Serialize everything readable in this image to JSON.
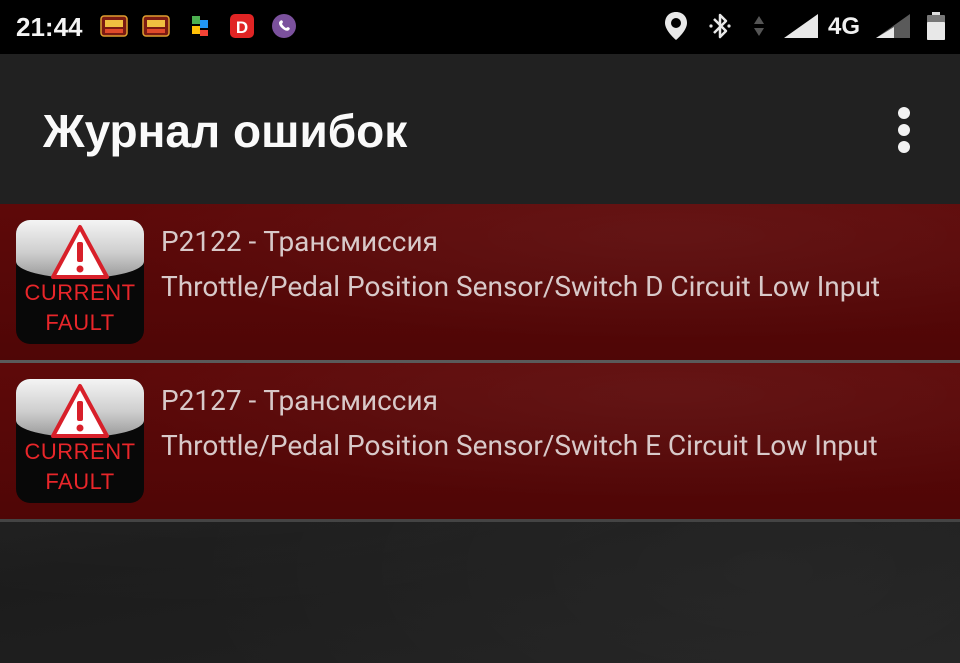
{
  "status_bar": {
    "time": "21:44",
    "network": "4G",
    "notification_icons": [
      "obd-app-icon",
      "obd-app-icon",
      "puzzle-icon",
      "d-app-icon",
      "viber-icon"
    ],
    "system_icons": [
      "location-icon",
      "bluetooth-icon",
      "data-arrows-icon",
      "signal-icon",
      "signal-icon",
      "battery-icon"
    ]
  },
  "app_bar": {
    "title": "Журнал ошибок",
    "overflow_icon": "more-vert-icon"
  },
  "faults": [
    {
      "code": "P2122 - Трансмиссия",
      "description": "Throttle/Pedal Position Sensor/Switch D Circuit Low Input",
      "badge_line1": "CURRENT",
      "badge_line2": "FAULT"
    },
    {
      "code": "P2127 - Трансмиссия",
      "description": "Throttle/Pedal Position Sensor/Switch E Circuit Low Input",
      "badge_line1": "CURRENT",
      "badge_line2": "FAULT"
    }
  ],
  "colors": {
    "status_bar": "#000000",
    "app_bar": "#212121",
    "row_background": "#560707",
    "badge_text": "#e8262a",
    "warning_triangle": "#d8202a"
  }
}
